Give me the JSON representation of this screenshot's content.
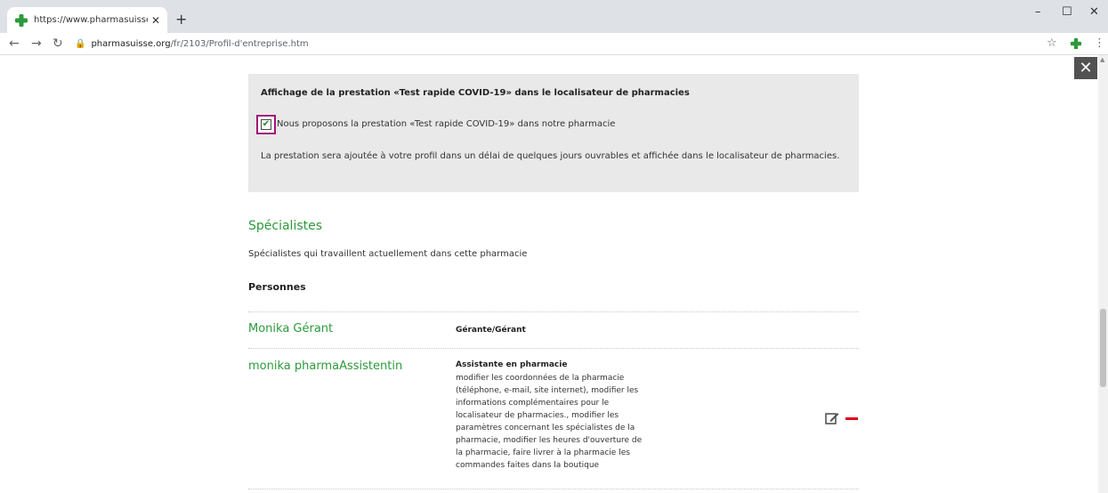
{
  "browser": {
    "tab_title": "https://www.pharmasuisse.org/fr",
    "tab_close": "✕",
    "new_tab": "+",
    "url_host": "pharmasuisse.org",
    "url_path": "/fr/2103/Profil-d'entreprise.htm",
    "window_min": "–",
    "window_max": "☐",
    "window_close": "✕"
  },
  "covid": {
    "title": "Affichage de la prestation «Test rapide COVID-19» dans le localisateur de pharmacies",
    "checkbox_label": "Nous proposons la prestation «Test rapide COVID-19» dans notre pharmacie",
    "checked": true,
    "note": "La prestation sera ajoutée à votre profil dans un délai de quelques jours ouvrables et affichée dans le localisateur de pharmacies."
  },
  "specialists": {
    "title": "Spécialistes",
    "description": "Spécialistes qui travaillent actuellement dans cette pharmacie",
    "persons_heading": "Personnes",
    "persons": [
      {
        "name": "Monika Gérant",
        "role": "Gérante/Gérant",
        "description": []
      },
      {
        "name": "monika pharmaAssistentin",
        "role": "Assistante en pharmacie",
        "description": [
          "modifier les coordonnées de la pharmacie",
          "(téléphone, e-mail, site internet), modifier les",
          "informations complémentaires pour le",
          "localisateur de pharmacies., modifier les",
          "paramètres concernant les spécialistes de la",
          "pharmacie, modifier les heures d'ouverture de",
          "la pharmacie, faire livrer à la pharmacie les",
          "commandes faites dans la boutique"
        ]
      }
    ]
  },
  "colors": {
    "brand_green": "#2c9a3c",
    "checkbox_highlight": "#a3127a",
    "remove_red": "#e3001b"
  }
}
